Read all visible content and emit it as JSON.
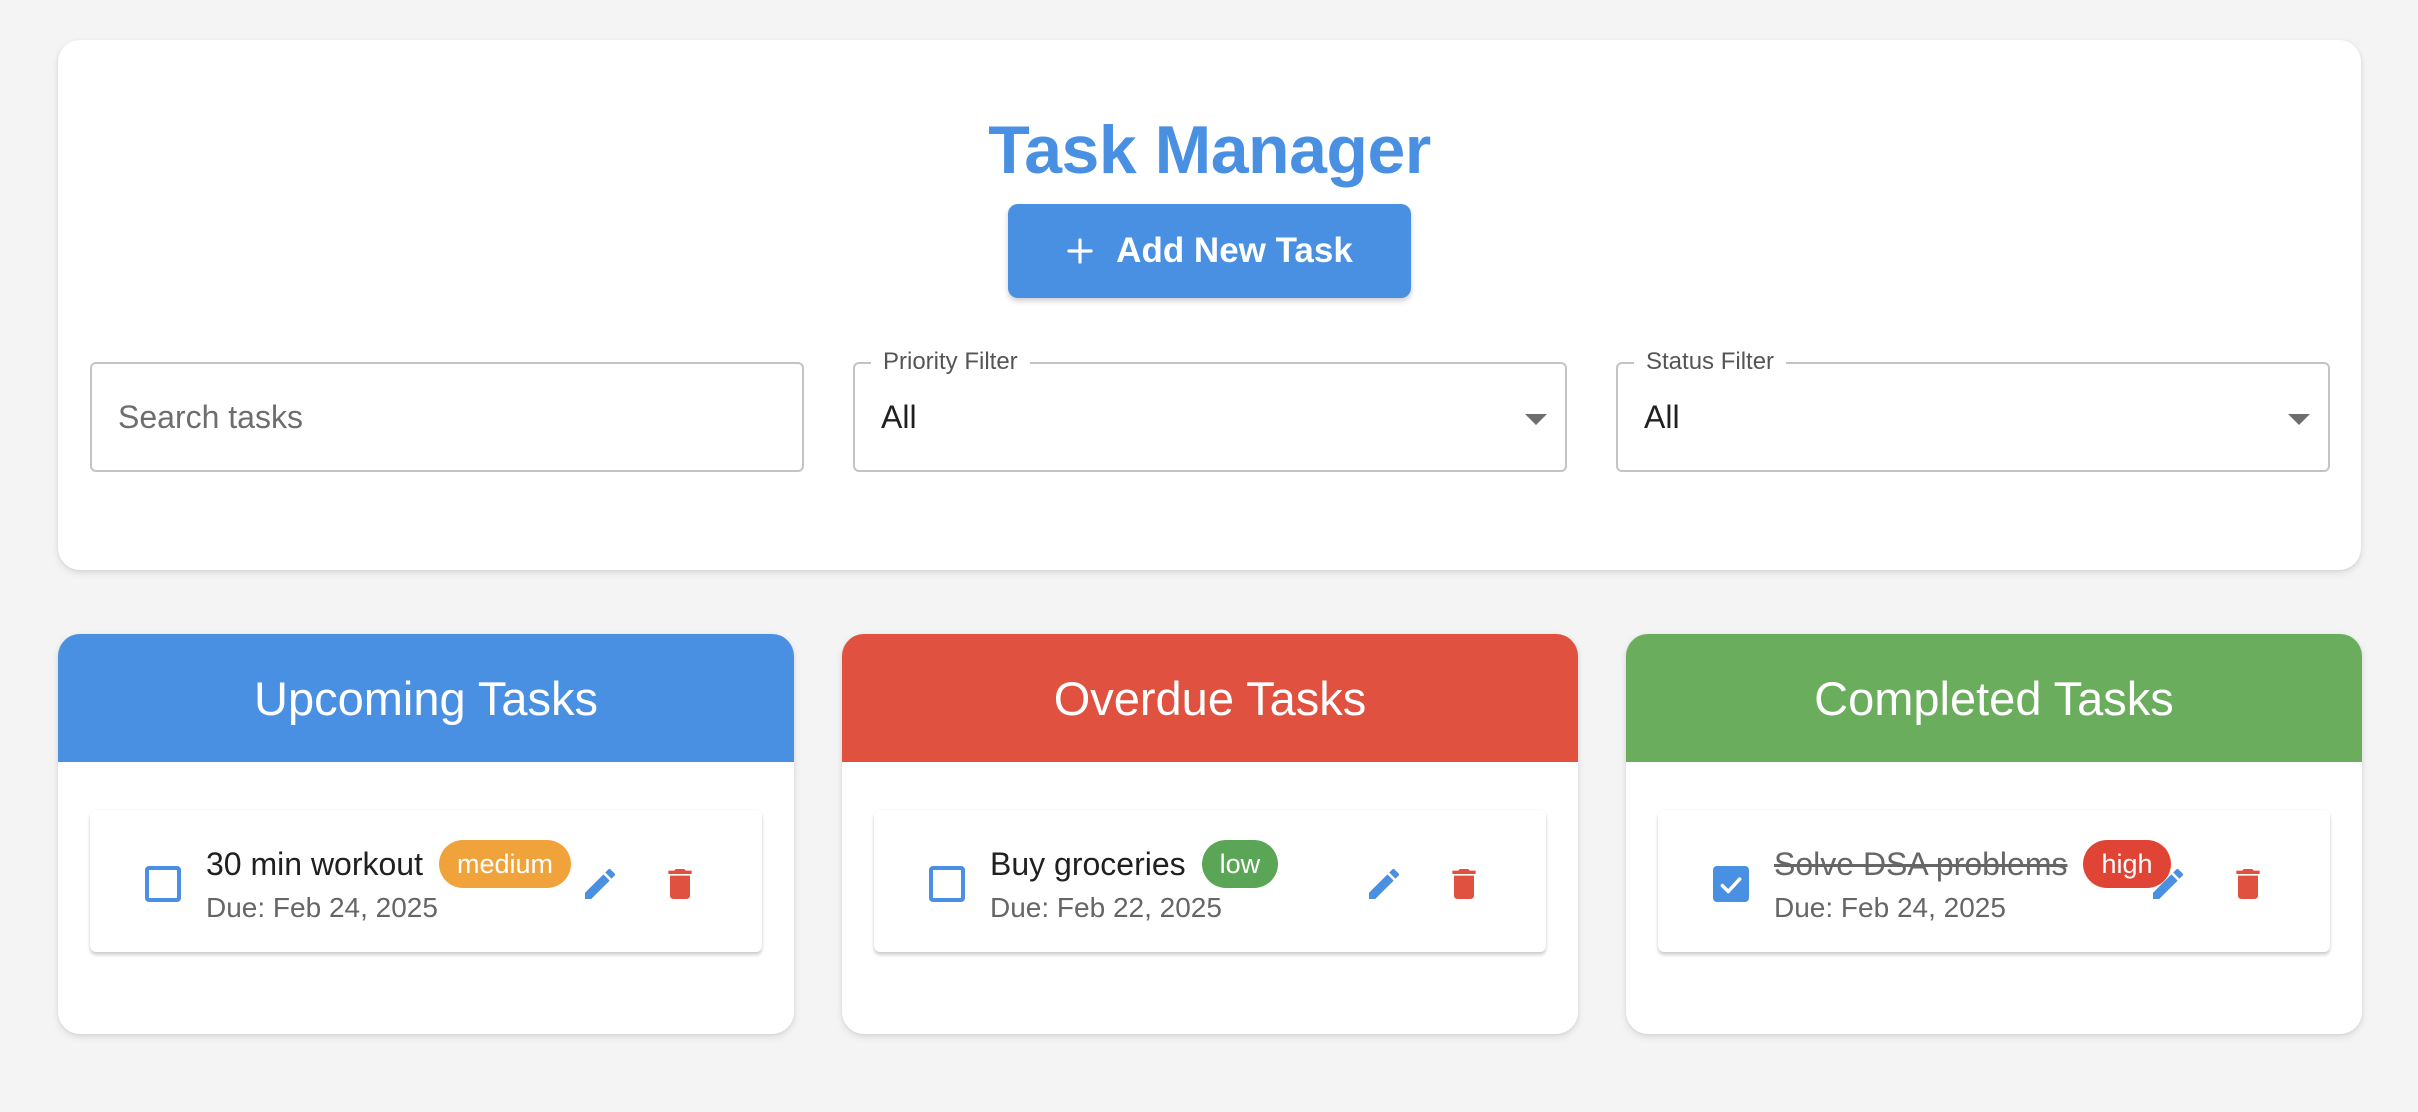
{
  "app": {
    "title": "Task Manager",
    "add_button_label": "Add New Task"
  },
  "filters": {
    "search": {
      "placeholder": "Search tasks",
      "value": ""
    },
    "priority": {
      "label": "Priority Filter",
      "value": "All"
    },
    "status": {
      "label": "Status Filter",
      "value": "All"
    }
  },
  "columns": [
    {
      "title": "Upcoming Tasks",
      "color": "#4a90e2",
      "task": {
        "title": "30 min workout",
        "priority": "medium",
        "priority_color": "#f0a23b",
        "due": "Due: Feb 24, 2025",
        "completed": false
      }
    },
    {
      "title": "Overdue Tasks",
      "color": "#e05140",
      "task": {
        "title": "Buy groceries",
        "priority": "low",
        "priority_color": "#5aa656",
        "due": "Due: Feb 22, 2025",
        "completed": false
      }
    },
    {
      "title": "Completed Tasks",
      "color": "#6aad5c",
      "task": {
        "title": "Solve DSA problems",
        "priority": "high",
        "priority_color": "#e04434",
        "due": "Due: Feb 24, 2025",
        "completed": true
      }
    }
  ],
  "icons": {
    "add": "plus-icon",
    "edit": "pencil-icon",
    "delete": "trash-icon",
    "dropdown": "caret-down-icon",
    "checkbox_checked": "check-icon"
  },
  "colors": {
    "accent": "#4a90e2",
    "edit_icon": "#4a90e2",
    "delete_icon": "#e05140",
    "background": "#f4f4f4"
  }
}
